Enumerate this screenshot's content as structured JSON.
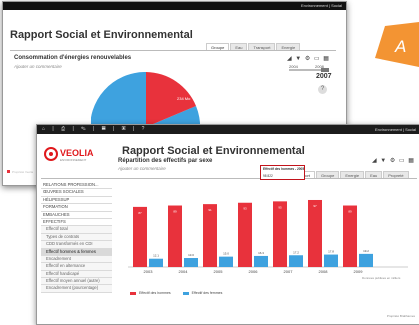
{
  "back_window": {
    "top_links": "Environnement | Social",
    "title": "Rapport Social et Environnemental",
    "tabs": [
      "Groupe",
      "Eau",
      "Transport",
      "Energie"
    ],
    "active_tab": 0,
    "chart_title": "Consommation d'énergies renouvelables",
    "comment": "Ajouter un commentaire",
    "year_from": "2004",
    "year_to": "2008",
    "selected_year": "2007",
    "help": "?",
    "pie_label": "234 Mo",
    "footer": "Propriété Veolia",
    "colors": {
      "slice_a": "#e8323c",
      "slice_b": "#3ea2df"
    }
  },
  "front_window": {
    "top_icons": [
      "home-icon",
      "print-icon",
      "edit-icon",
      "chart-icon",
      "grid-icon",
      "help-icon"
    ],
    "top_icon_glyphs": "⌂ | ⎙ | ✎ | ▦ | ▣ | ?",
    "top_links": "Environnement | Social",
    "brand": "VEOLIA",
    "brand_sub": "ENVIRONNEMENT",
    "title": "Rapport Social et Environnemental",
    "tabs": [
      "Transport",
      "Groupe",
      "Energie",
      "Eau",
      "Propreté"
    ],
    "active_tab": 0,
    "tools_glyphs": "◢ ▼ ⚙ ▭ ▦",
    "sidebar": [
      {
        "label": "RELATIONS PROFESSION...",
        "level": 0
      },
      {
        "label": "ŒUVRES SOCIALES",
        "level": 0
      },
      {
        "label": "HÉLIPESSUP",
        "level": 0
      },
      {
        "label": "FORMATION",
        "level": 0
      },
      {
        "label": "EMBAUCHES",
        "level": 0
      },
      {
        "label": "EFFECTIFS",
        "level": 0
      },
      {
        "label": "Effectif total",
        "level": 1
      },
      {
        "label": "Types de contrats",
        "level": 1
      },
      {
        "label": "CDD transformés en CDI",
        "level": 1
      },
      {
        "label": "Effectif hommes & femmes",
        "level": 1,
        "active": true
      },
      {
        "label": "Encadrement",
        "level": 1
      },
      {
        "label": "Effectif en alternance",
        "level": 1
      },
      {
        "label": "Effectif handicapé",
        "level": 1
      },
      {
        "label": "Effectif moyen annuel (autre)",
        "level": 1
      },
      {
        "label": "Encadrement (pourcentage)",
        "level": 1
      }
    ],
    "chart_title": "Répartition des effectifs par sexe",
    "comment": "Ajouter un commentaire",
    "tooltip_line1": "Effectif des hommes - 2005",
    "tooltip_line2": "98 822",
    "source": "Données publiées en milliers",
    "footer": "Propriété Bralthames",
    "colors": {
      "men": "#e8323c",
      "women": "#3ea2df",
      "brand": "#e0181c"
    }
  },
  "chart_data": {
    "type": "bar",
    "categories": [
      "2003",
      "2004",
      "2005",
      "2006",
      "2007",
      "2008",
      "2009"
    ],
    "series": [
      {
        "name": "Effectif des hommes",
        "values": [
          87,
          89,
          91,
          93,
          95,
          97,
          89
        ]
      },
      {
        "name": "Effectif des femmes",
        "values": [
          12,
          13,
          15,
          16,
          17,
          18,
          19
        ]
      }
    ],
    "data_labels": {
      "men": [
        "87",
        "89",
        "91",
        "93",
        "95",
        "97",
        "89"
      ],
      "women": [
        "12.1",
        "13.0",
        "15.0",
        "16.3",
        "17.2",
        "17.8",
        "19.2"
      ]
    },
    "ylim": [
      0,
      110
    ],
    "grid": false,
    "legend": "bottom-left"
  }
}
